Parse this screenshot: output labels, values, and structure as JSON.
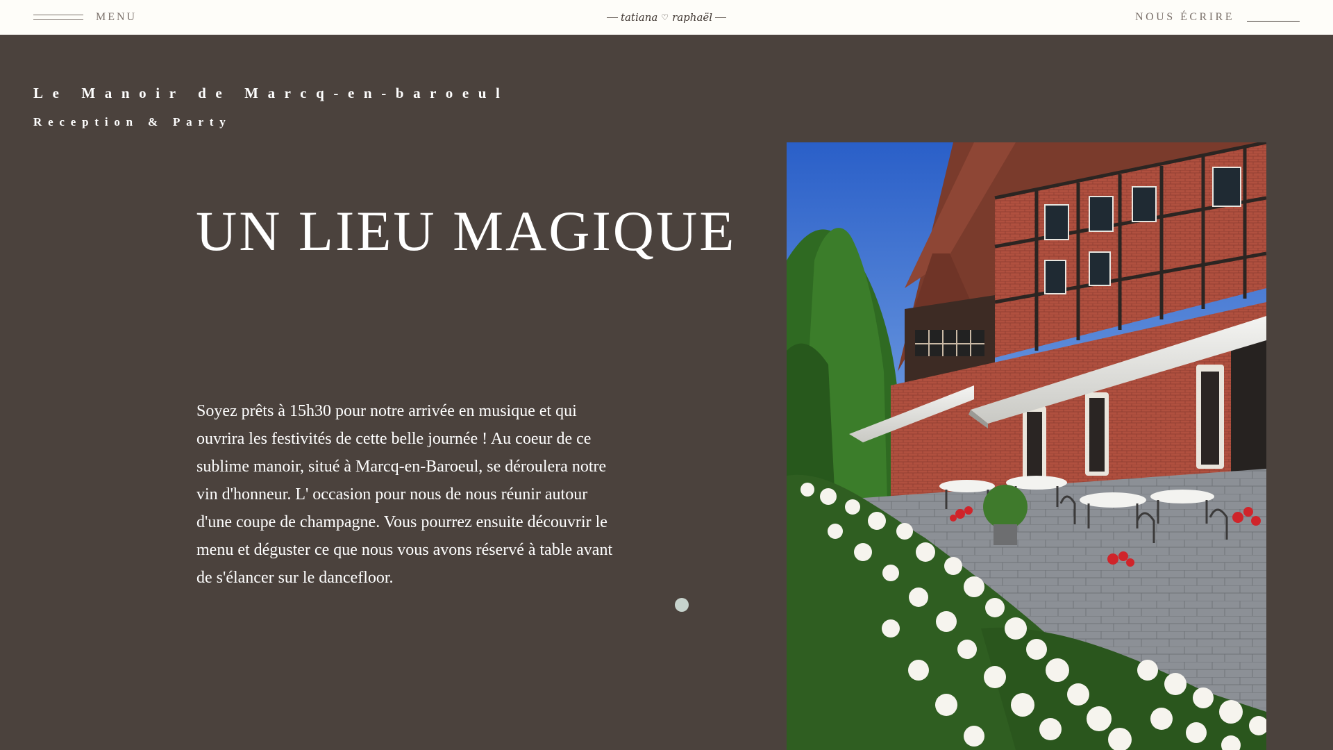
{
  "header": {
    "menu_icon": "hamburger-icon",
    "menu_label": "MENU",
    "logo": {
      "left_name": "tatiana",
      "heart_icon": "heart-icon",
      "right_name": "raphaël"
    },
    "contact_label": "NOUS ÉCRIRE"
  },
  "hero": {
    "venue_title": "Le Manoir de Marcq-en-baroeul",
    "venue_subtitle": "Reception & Party",
    "heading": "UN LIEU MAGIQUE",
    "body": "Soyez prêts à 15h30 pour notre arrivée en musique et qui ouvrira les festivités de cette belle journée ! Au coeur de ce sublime manoir, situé à Marcq-en-Baroeul, se déroulera notre vin d'honneur. L' occasion pour nous de nous réunir autour d'une coupe de champagne. Vous pourrez ensuite découvrir le menu et déguster ce que nous vous avons réservé à table avant de s'élancer sur le dancefloor."
  },
  "colors": {
    "background": "#4b423d",
    "header_background": "#fefdf9",
    "header_text": "#7b716b",
    "text": "#ffffff",
    "scroll_dot": "#c7d3cd"
  }
}
